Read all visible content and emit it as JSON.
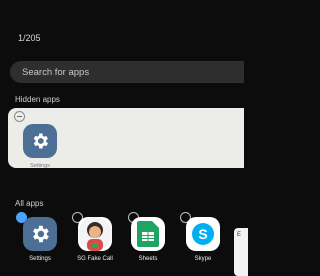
{
  "header": {
    "counter": "1/205"
  },
  "search": {
    "placeholder": "Search for apps"
  },
  "hidden_apps": {
    "label": "Hidden apps",
    "items": [
      {
        "name": "Settings",
        "icon": "gear-icon"
      }
    ]
  },
  "all_apps": {
    "label": "All apps",
    "items": [
      {
        "name": "Settings",
        "icon": "gear-icon",
        "selected": true
      },
      {
        "name": "SG Fake Call",
        "icon": "avatar-icon",
        "selected": false
      },
      {
        "name": "Sheets",
        "icon": "sheets-icon",
        "selected": false
      },
      {
        "name": "Skype",
        "icon": "skype-icon",
        "selected": false
      }
    ]
  },
  "edge_card": {
    "text": "E"
  },
  "colors": {
    "background": "#0c0c0c",
    "settings_icon": "#4d6f95",
    "sheets_green": "#1fa463",
    "skype_blue": "#00aff0",
    "panel": "#ecece9"
  }
}
